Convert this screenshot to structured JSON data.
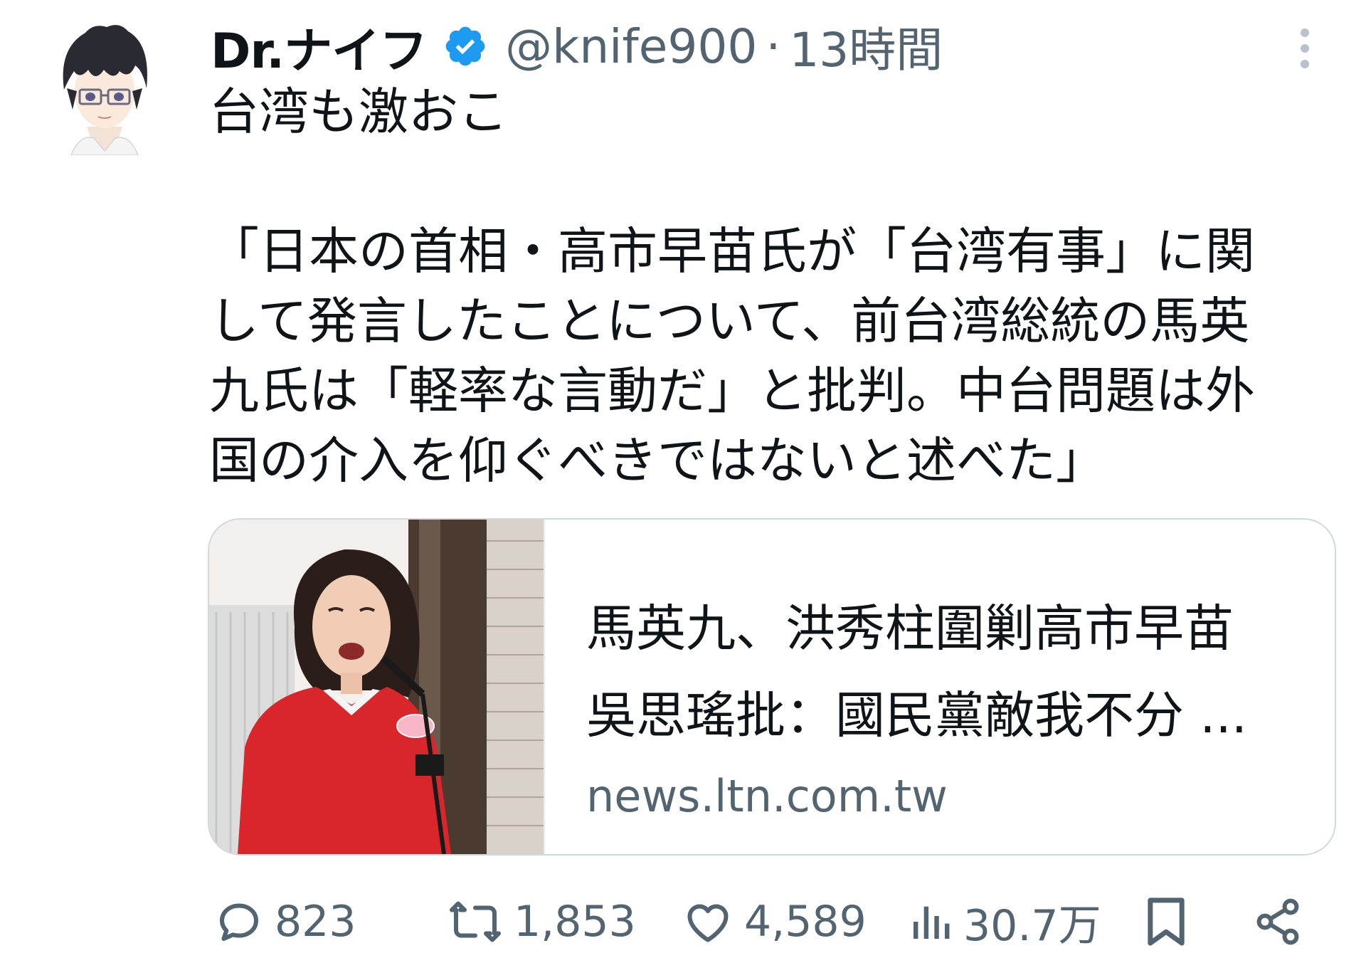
{
  "author": {
    "display_name": "Dr.ナイフ",
    "handle": "@knife900",
    "separator": "·",
    "time": "13時間",
    "verified": true
  },
  "tweet": {
    "lines": [
      "台湾も激おこ",
      "",
      "「日本の首相・高市早苗氏が「台湾有事」に関",
      "して発言したことについて、前台湾総統の馬英",
      "九氏は「軽率な言動だ」と批判。中台問題は外",
      "国の介入を仰ぐべきではないと述べた」"
    ]
  },
  "card": {
    "title_line1": "馬英九、洪秀柱圍剿高市早苗",
    "title_line2": "吳思瑤批：國民黨敵我不分 ...",
    "domain": "news.ltn.com.tw"
  },
  "actions": {
    "replies": "823",
    "reposts": "1,853",
    "likes": "4,589",
    "views": "30.7万"
  },
  "icons": {
    "verified": "verified-badge-icon",
    "more": "more-vertical-icon",
    "reply": "reply-icon",
    "repost": "repost-icon",
    "like": "heart-icon",
    "views": "views-icon",
    "bookmark": "bookmark-icon",
    "share": "share-icon"
  },
  "colors": {
    "text_primary": "#0f1419",
    "text_secondary": "#536471",
    "verified_blue": "#1d9bf0",
    "card_border": "#cfd9de"
  }
}
